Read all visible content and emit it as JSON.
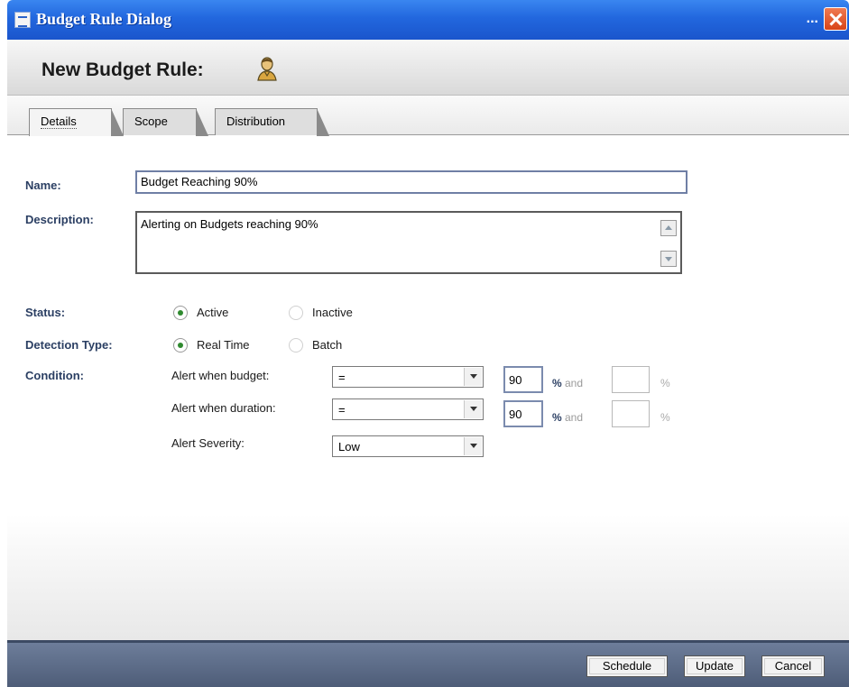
{
  "window": {
    "title": "Budget Rule Dialog",
    "title_extra": "...",
    "close_glyph": ""
  },
  "header": {
    "title": "New Budget Rule:"
  },
  "tabs": [
    {
      "label": "Details",
      "active": true
    },
    {
      "label": "Scope",
      "active": false
    },
    {
      "label": "Distribution",
      "active": false
    }
  ],
  "form": {
    "name_label": "Name:",
    "name_value": "Budget Reaching 90%",
    "description_label": "Description:",
    "description_value": "Alerting on Budgets reaching 90%",
    "status_label": "Status:",
    "status_options": [
      {
        "label": "Active",
        "checked": true
      },
      {
        "label": "Inactive",
        "checked": false
      }
    ],
    "detection_label": "Detection Type:",
    "detection_options": [
      {
        "label": "Real Time",
        "checked": true
      },
      {
        "label": "Batch",
        "checked": false
      }
    ],
    "condition_label": "Condition:",
    "conditions": [
      {
        "label": "Alert when budget:",
        "operator": "=",
        "value1": "90",
        "unit": "%",
        "and": "and",
        "value2": "",
        "unit2": "%"
      },
      {
        "label": "Alert when duration:",
        "operator": "=",
        "value1": "90",
        "unit": "%",
        "and": "and",
        "value2": "",
        "unit2": "%"
      }
    ],
    "severity_label": "Alert Severity:",
    "severity_value": "Low"
  },
  "footer": {
    "schedule_label": "Schedule",
    "update_label": "Update",
    "cancel_label": "Cancel"
  },
  "colors": {
    "titlebar": "#2267de",
    "label_blue": "#2b3f63",
    "footer": "#56657f",
    "radio_checked": "#2f8a2f"
  }
}
